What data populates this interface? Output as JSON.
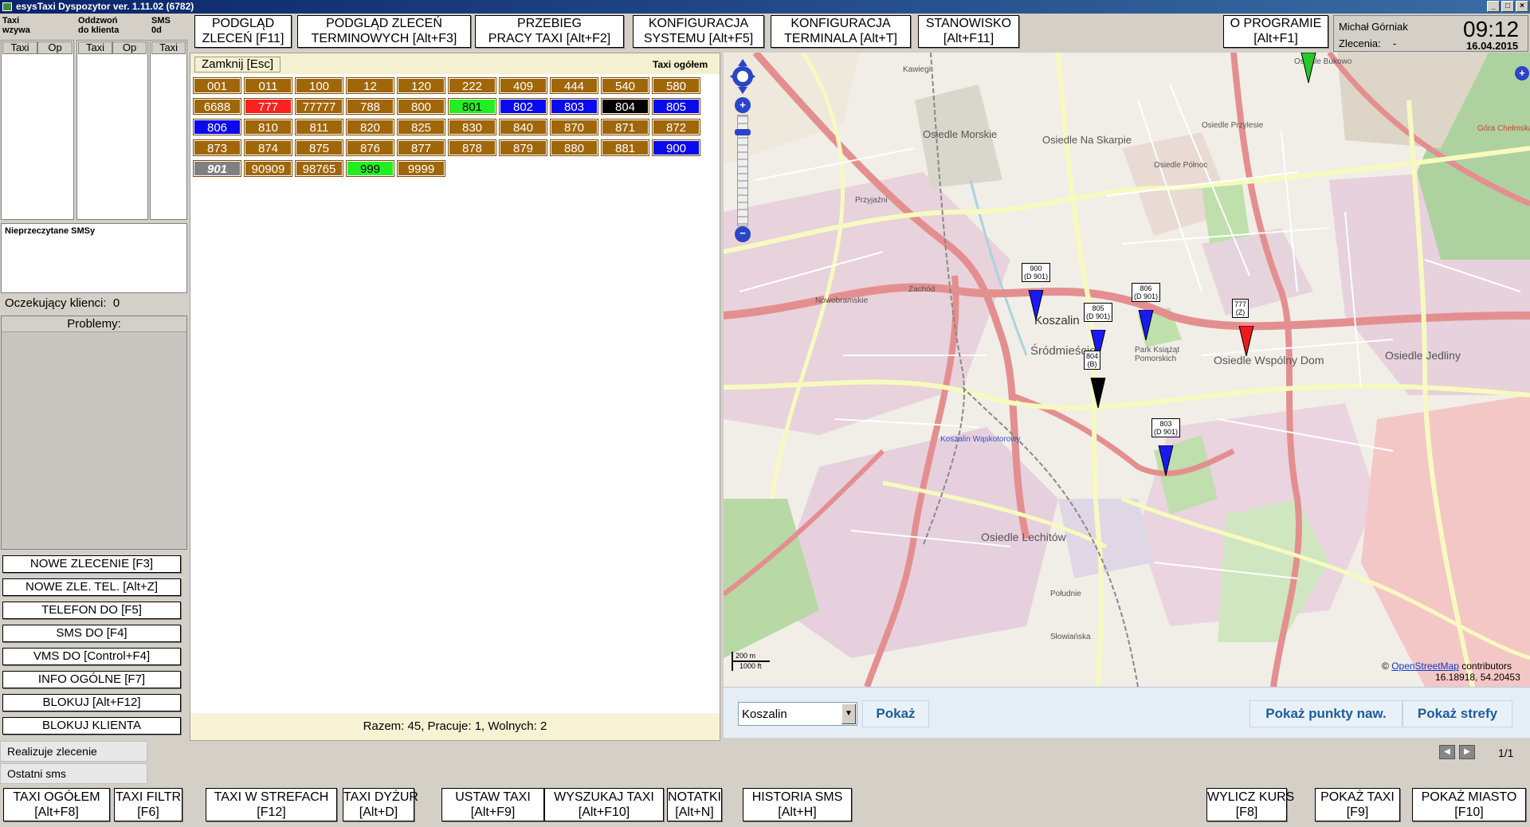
{
  "window": {
    "title": "esysTaxi Dyspozytor ver. 1.11.02 (6782)",
    "controls": [
      "_",
      "□",
      "×"
    ]
  },
  "top_buttons": [
    {
      "line1": "PODGLĄD",
      "line2": "ZLECEŃ [F11]"
    },
    {
      "line1": "PODGLĄD ZLECEŃ",
      "line2": "TERMINOWYCH [Alt+F3]"
    },
    {
      "line1": "PRZEBIEG",
      "line2": "PRACY TAXI [Alt+F2]"
    },
    {
      "line1": "KONFIGURACJA",
      "line2": "SYSTEMU [Alt+F5]"
    },
    {
      "line1": "KONFIGURACJA",
      "line2": "TERMINALA [Alt+T]"
    },
    {
      "line1": "STANOWISKO",
      "line2": "[Alt+F11]"
    },
    {
      "line1": "O PROGRAMIE",
      "line2": "[Alt+F1]"
    }
  ],
  "user_panel": {
    "name": "Michał Górniak",
    "orders_label": "Zlecenia:",
    "orders_value": "-",
    "time": "09:12",
    "date": "16.04.2015"
  },
  "left_lists": {
    "calling": {
      "title1": "Taxi",
      "title2": "wzywa",
      "col1": "Taxi",
      "col2": "Op"
    },
    "pickup": {
      "title1": "Oddzwoń",
      "title2": "do klienta",
      "col1": "Taxi",
      "col2": "Op"
    },
    "sms": {
      "title1": "SMS",
      "title2": "0d",
      "col1": "Taxi"
    }
  },
  "unread_sms": {
    "title": "Nieprzeczytane SMSy"
  },
  "waiting_clients": {
    "label": "Oczekujący klienci:",
    "value": "0"
  },
  "problems": {
    "title": "Problemy:"
  },
  "left_buttons": [
    "NOWE ZLECENIE [F3]",
    "NOWE ZLE. TEL. [Alt+Z]",
    "TELEFON DO [F5]",
    "SMS DO [F4]",
    "VMS DO [Control+F4]",
    "INFO OGÓLNE [F7]",
    "BLOKUJ [Alt+F12]",
    "BLOKUJ KLIENTA"
  ],
  "taxi_panel": {
    "close_label": "Zamknij [Esc]",
    "title": "Taxi ogółem",
    "summary": "Razem: 45, Pracuje: 1, Wolnych: 2",
    "colors": {
      "default": "#a0660a",
      "red": "#ff2020",
      "green": "#22ee22",
      "blue": "#0a0aee",
      "black": "#000000",
      "gray": "#808080"
    },
    "rows": [
      [
        {
          "id": "001",
          "c": "default"
        },
        {
          "id": "011",
          "c": "default"
        },
        {
          "id": "100",
          "c": "default"
        },
        {
          "id": "12",
          "c": "default"
        },
        {
          "id": "120",
          "c": "default"
        },
        {
          "id": "222",
          "c": "default"
        },
        {
          "id": "409",
          "c": "default"
        },
        {
          "id": "444",
          "c": "default"
        },
        {
          "id": "540",
          "c": "default"
        },
        {
          "id": "580",
          "c": "default"
        }
      ],
      [
        {
          "id": "6688",
          "c": "default"
        },
        {
          "id": "777",
          "c": "red"
        },
        {
          "id": "77777",
          "c": "default"
        },
        {
          "id": "788",
          "c": "default"
        },
        {
          "id": "800",
          "c": "default"
        },
        {
          "id": "801",
          "c": "green"
        },
        {
          "id": "802",
          "c": "blue"
        },
        {
          "id": "803",
          "c": "blue"
        },
        {
          "id": "804",
          "c": "black"
        },
        {
          "id": "805",
          "c": "blue"
        }
      ],
      [
        {
          "id": "806",
          "c": "blue"
        },
        {
          "id": "810",
          "c": "default"
        },
        {
          "id": "811",
          "c": "default"
        },
        {
          "id": "820",
          "c": "default"
        },
        {
          "id": "825",
          "c": "default"
        },
        {
          "id": "830",
          "c": "default"
        },
        {
          "id": "840",
          "c": "default"
        },
        {
          "id": "870",
          "c": "default"
        },
        {
          "id": "871",
          "c": "default"
        },
        {
          "id": "872",
          "c": "default"
        }
      ],
      [
        {
          "id": "873",
          "c": "default"
        },
        {
          "id": "874",
          "c": "default"
        },
        {
          "id": "875",
          "c": "default"
        },
        {
          "id": "876",
          "c": "default"
        },
        {
          "id": "877",
          "c": "default"
        },
        {
          "id": "878",
          "c": "default"
        },
        {
          "id": "879",
          "c": "default"
        },
        {
          "id": "880",
          "c": "default"
        },
        {
          "id": "881",
          "c": "default"
        },
        {
          "id": "900",
          "c": "blue"
        }
      ],
      [
        {
          "id": "901",
          "c": "gray"
        },
        {
          "id": "90909",
          "c": "default"
        },
        {
          "id": "98765",
          "c": "default"
        },
        {
          "id": "999",
          "c": "green"
        },
        {
          "id": "9999",
          "c": "default"
        }
      ]
    ]
  },
  "map": {
    "labels": [
      "Osiedle Morskie",
      "Osiedle Na Skarpie",
      "Osiedle Przylesie",
      "Osiedle Północ",
      "Koszalin",
      "Śródmieście",
      "Osiedle Lechitów",
      "Osiedle Wspólny Dom",
      "Osiedle Jedliny",
      "Park Książąt Pomorskich",
      "Koszalin Wąskotorowy",
      "Nowobramskie",
      "Zachód",
      "Przyjaźni",
      "Kawiegi",
      "Osiedle Bukowo",
      "Góra Chełmska",
      "Słowiańska",
      "Południe"
    ],
    "pins": [
      {
        "label1": "900",
        "label2": "(D 901)",
        "color": "#1a1aee"
      },
      {
        "label1": "805",
        "label2": "(D 901)",
        "color": "#1a1aee"
      },
      {
        "label1": "806",
        "label2": "(D 901)",
        "color": "#1a1aee"
      },
      {
        "label1": "804",
        "label2": "(B)",
        "color": "#000000"
      },
      {
        "label1": "777",
        "label2": "(Z)",
        "color": "#ee1a1a"
      },
      {
        "label1": "803",
        "label2": "(D 901)",
        "color": "#1a1aee"
      }
    ],
    "scale_m": "200 m",
    "scale_ft": "1000 ft",
    "attribution_prefix": "©",
    "attribution_link": "OpenStreetMap",
    "attribution_suffix": "contributors",
    "coords": "16.18918, 54.20453"
  },
  "map_toolbar": {
    "city_value": "Koszalin",
    "show_label": "Pokaż",
    "nav_points_label": "Pokaż punkty naw.",
    "zones_label": "Pokaż strefy"
  },
  "bottom_tabs": [
    "Realizuje zlecenie",
    "Ostatni sms"
  ],
  "pager": "1/1",
  "function_buttons": [
    {
      "line1": "TAXI OGÓŁEM",
      "line2": "[Alt+F8]"
    },
    {
      "line1": "TAXI FILTR",
      "line2": "[F6]"
    },
    {
      "line1": "TAXI W STREFACH",
      "line2": "[F12]"
    },
    {
      "line1": "TAXI DYŻUR",
      "line2": "[Alt+D]"
    },
    {
      "line1": "USTAW TAXI",
      "line2": "[Alt+F9]"
    },
    {
      "line1": "WYSZUKAJ TAXI",
      "line2": "[Alt+F10]"
    },
    {
      "line1": "NOTATKI",
      "line2": "[Alt+N]"
    },
    {
      "line1": "HISTORIA SMS",
      "line2": "[Alt+H]"
    },
    {
      "line1": "WYLICZ KURS",
      "line2": "[F8]"
    },
    {
      "line1": "POKAŻ TAXI",
      "line2": "[F9]"
    },
    {
      "line1": "POKAŻ MIASTO",
      "line2": "[F10]"
    }
  ]
}
